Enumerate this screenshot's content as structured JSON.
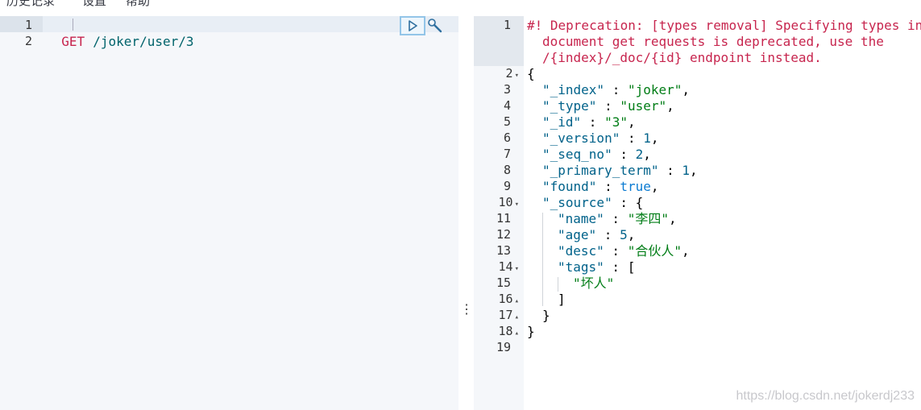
{
  "menu": {
    "history": "历史记录",
    "settings": "设置",
    "help": "帮助"
  },
  "request": {
    "line_numbers": [
      "1",
      "2"
    ],
    "method": "GET",
    "path": "/joker/user/3"
  },
  "response": {
    "line_numbers": [
      "1",
      "2",
      "3",
      "4",
      "5",
      "6",
      "7",
      "8",
      "9",
      "10",
      "11",
      "12",
      "13",
      "14",
      "15",
      "16",
      "17",
      "18",
      "19"
    ],
    "deprecation_lines": [
      "#! Deprecation: [types removal] Specifying types in",
      "document get requests is deprecated, use the",
      "/{index}/_doc/{id} endpoint instead."
    ],
    "json": {
      "open_brace": "{",
      "index_key": "\"_index\"",
      "index_val": "\"joker\"",
      "type_key": "\"_type\"",
      "type_val": "\"user\"",
      "id_key": "\"_id\"",
      "id_val": "\"3\"",
      "version_key": "\"_version\"",
      "version_val": "1",
      "seq_key": "\"_seq_no\"",
      "seq_val": "2",
      "term_key": "\"_primary_term\"",
      "term_val": "1",
      "found_key": "\"found\"",
      "found_val": "true",
      "source_key": "\"_source\"",
      "name_key": "\"name\"",
      "name_val": "\"李四\"",
      "age_key": "\"age\"",
      "age_val": "5",
      "desc_key": "\"desc\"",
      "desc_val": "\"合伙人\"",
      "tags_key": "\"tags\"",
      "tag_item": "\"坏人\"",
      "close_bracket": "]",
      "close_source": "}",
      "close_brace": "}"
    }
  },
  "watermark": "https://blog.csdn.net/jokerdj233",
  "colors": {
    "method": "#c7254e",
    "url": "#00636b",
    "string": "#007d16",
    "key": "#00628a",
    "run_border": "#93c5e8"
  },
  "icons": {
    "run": "play-icon",
    "settings": "wrench-icon",
    "resize": "vertical-dots-icon"
  }
}
